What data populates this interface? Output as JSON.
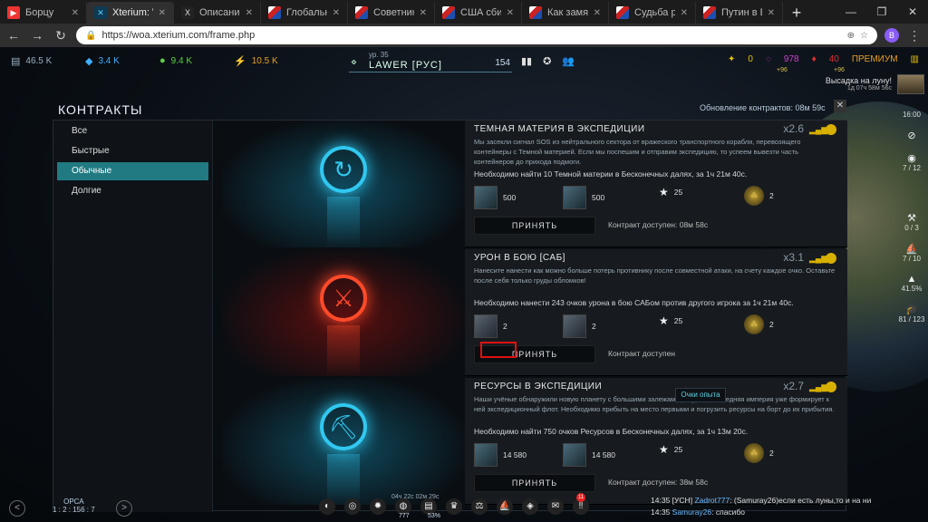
{
  "browser": {
    "tabs": [
      {
        "title": "Борцу",
        "fav": "▶",
        "kind": "yt"
      },
      {
        "title": "Xterium: W",
        "fav": "✕",
        "kind": "xt",
        "active": true
      },
      {
        "title": "Описание",
        "fav": "X",
        "kind": "x2"
      },
      {
        "title": "Глобальна",
        "fav": "",
        "kind": "flag"
      },
      {
        "title": "Советник",
        "fav": "",
        "kind": "flag"
      },
      {
        "title": "США сбил",
        "fav": "",
        "kind": "flag"
      },
      {
        "title": "Как замят",
        "fav": "",
        "kind": "flag"
      },
      {
        "title": "Судьба ра",
        "fav": "",
        "kind": "flag"
      },
      {
        "title": "Путин в Бр",
        "fav": "",
        "kind": "flag"
      }
    ],
    "url": "https://woa.xterium.com/frame.php",
    "profile": "B"
  },
  "resources": [
    {
      "icon": "▤",
      "value": "46.5 K",
      "color": "#9ab0c0"
    },
    {
      "icon": "◆",
      "value": "3.4 K",
      "color": "#3fb0ff"
    },
    {
      "icon": "●",
      "value": "9.4 K",
      "color": "#5fd040"
    },
    {
      "icon": "⚡",
      "value": "10.5 K",
      "color": "#e8a020"
    }
  ],
  "player": {
    "level": "ур. 35",
    "name": "LAWER [РУС]",
    "points": "154"
  },
  "top_right": {
    "v0": "0",
    "v1": "978",
    "v1_sub": "+96",
    "v2": "40",
    "v2_sub": "+96",
    "premium": "ПРЕМИУМ"
  },
  "landing": {
    "text": "Высадка на луну!",
    "time": "1д 07ч 58м 56с"
  },
  "contracts": {
    "title": "КОНТРАКТЫ",
    "update": "Обновление контрактов: 08м 59с",
    "close": "✕",
    "categories": [
      {
        "label": "Все",
        "selected": false
      },
      {
        "label": "Быстрые",
        "selected": false
      },
      {
        "label": "Обычные",
        "selected": true
      },
      {
        "label": "Долгие",
        "selected": false
      }
    ],
    "items": [
      {
        "title": "ТЕМНАЯ МАТЕРИЯ В ЭКСПЕДИЦИИ",
        "mult": "x2.6",
        "desc": "Мы засекли сигнал SOS из нейтрального сектора от вражеского транспортного корабля, перевозящего контейнеры с Темной материей. Если мы поспешим и отправим экспедицию, то успеем вывезти часть контейнеров до прихода подмоги.",
        "goal": "Необходимо найти 10 Темной материи в Бесконечных далях, за 1ч 21м 40с.",
        "rewards": [
          "500",
          "500",
          "25",
          "2"
        ],
        "accept": "ПРИНЯТЬ",
        "avail": "Контракт доступен: 08м 58с",
        "theme": "#0f4a5e",
        "icon": "↻"
      },
      {
        "title": "УРОН В БОЮ [САБ]",
        "mult": "x3.1",
        "desc": "Нанесите нанести как можно больше потерь противнику после совместной атаки, на счету каждое очко. Оставьте после себя только груды обломков!",
        "goal": "Необходимо нанести 243 очков урона в бою САБом против другого игрока за 1ч 21м 40с.",
        "rewards": [
          "2",
          "2",
          "25",
          "2"
        ],
        "accept": "ПРИНЯТЬ",
        "avail": "Контракт доступен",
        "theme": "#5a0f0f",
        "icon": "⚔"
      },
      {
        "title": "РЕСУРСЫ В ЭКСПЕДИЦИИ",
        "mult": "x2.7",
        "desc": "Наши учёные обнаружили новую планету с большими залежами ресурсов. Соседняя империя уже формирует к ней экспедиционный флот. Необходимо прибыть на место первыми и погрузить ресурсы на борт до их прибытия.",
        "goal": "Необходимо найти 750 очков Ресурсов в Бесконечных далях, за 1ч 13м 20с.",
        "rewards": [
          "14 580",
          "14 580",
          "25",
          "2"
        ],
        "accept": "ПРИНЯТЬ",
        "avail": "Контракт доступен: 38м 58с",
        "theme": "#0f4a5e",
        "icon": "⛏"
      }
    ]
  },
  "tooltip": "Очки опыта",
  "right_side": [
    {
      "icon": "",
      "value": "16:00"
    },
    {
      "icon": "⊘",
      "value": ""
    },
    {
      "icon": "◉",
      "value": "7 / 12"
    },
    {
      "icon": "⚒",
      "value": "0 / 3"
    },
    {
      "icon": "⛵",
      "value": "7 / 10"
    },
    {
      "icon": "▲",
      "value": "41.5%"
    },
    {
      "icon": "🎓",
      "value": "81 / 123"
    }
  ],
  "bottom": {
    "system": "ОРСА",
    "coords": "1 : 2 : 156 : 7",
    "timer": "04ч 22с 02м 29с",
    "v777": "777",
    "v53": "53%",
    "badge": "11",
    "chat": [
      {
        "time": "14:35",
        "tag": "[УСН]",
        "user": "Zadrot777",
        "text": ": (Samuray26)если есть луны,то и на ни"
      },
      {
        "time": "14:35",
        "tag": "",
        "user": "Samuray26",
        "text": ": спасибо"
      }
    ]
  }
}
